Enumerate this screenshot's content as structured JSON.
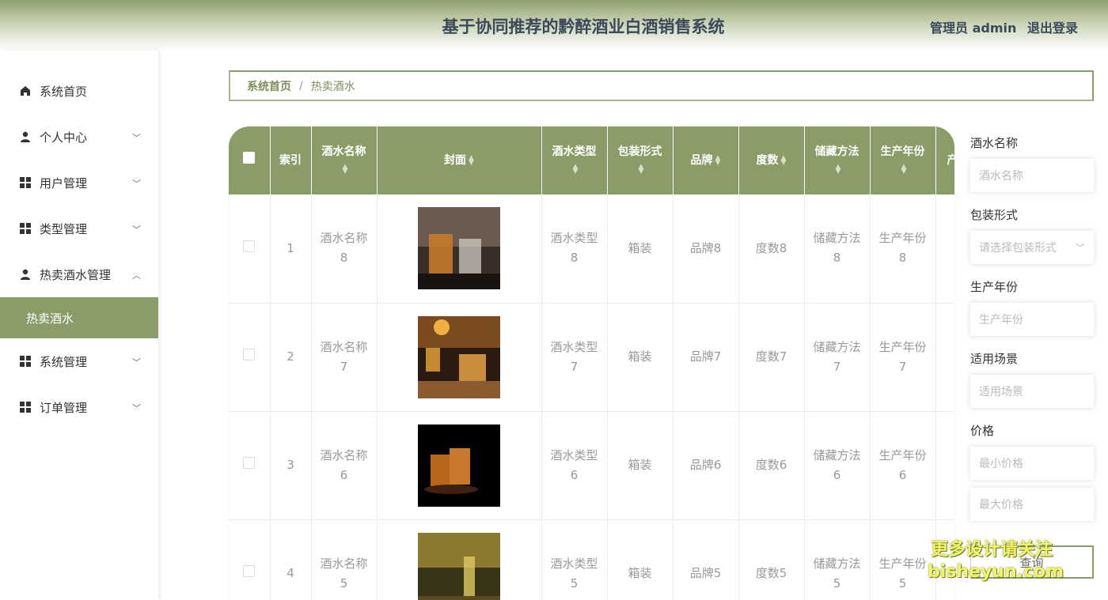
{
  "header": {
    "title": "基于协同推荐的黔醉酒业白酒销售系统",
    "user_label": "管理员 admin",
    "logout_label": "退出登录"
  },
  "sidebar": {
    "items": [
      {
        "label": "系统首页",
        "icon": "home-icon"
      },
      {
        "label": "个人中心",
        "icon": "user-icon"
      },
      {
        "label": "用户管理",
        "icon": "grid-icon"
      },
      {
        "label": "类型管理",
        "icon": "grid-icon"
      },
      {
        "label": "热卖酒水管理",
        "icon": "user-icon"
      },
      {
        "label": "系统管理",
        "icon": "grid-icon"
      },
      {
        "label": "订单管理",
        "icon": "grid-icon"
      }
    ],
    "sub_active": "热卖酒水"
  },
  "breadcrumb": {
    "home": "系统首页",
    "separator": "/",
    "current": "热卖酒水"
  },
  "table": {
    "headers": [
      "索引",
      "酒水名称",
      "封面",
      "酒水类型",
      "包装形式",
      "品牌",
      "度数",
      "储藏方法",
      "生产年份",
      "产"
    ],
    "rows": [
      {
        "index": "1",
        "name": "酒水名称8",
        "type": "酒水类型8",
        "pack": "箱装",
        "brand": "品牌8",
        "degree": "度数8",
        "storage": "储藏方法8",
        "year": "生产年份8"
      },
      {
        "index": "2",
        "name": "酒水名称7",
        "type": "酒水类型7",
        "pack": "箱装",
        "brand": "品牌7",
        "degree": "度数7",
        "storage": "储藏方法7",
        "year": "生产年份7"
      },
      {
        "index": "3",
        "name": "酒水名称6",
        "type": "酒水类型6",
        "pack": "箱装",
        "brand": "品牌6",
        "degree": "度数6",
        "storage": "储藏方法6",
        "year": "生产年份6"
      },
      {
        "index": "4",
        "name": "酒水名称5",
        "type": "酒水类型5",
        "pack": "箱装",
        "brand": "品牌5",
        "degree": "度数5",
        "storage": "储藏方法5",
        "year": "生产年份5"
      }
    ]
  },
  "filter": {
    "name_label": "酒水名称",
    "name_placeholder": "酒水名称",
    "pack_label": "包装形式",
    "pack_placeholder": "请选择包装形式",
    "year_label": "生产年份",
    "year_placeholder": "生产年份",
    "scene_label": "适用场景",
    "scene_placeholder": "适用场景",
    "price_label": "价格",
    "min_price_placeholder": "最小价格",
    "max_price_placeholder": "最大价格",
    "search_label": "查询"
  },
  "watermark": {
    "line1": "更多设计请关注",
    "line2": "bisheyun.com"
  },
  "colors": {
    "accent": "#8a9c68",
    "accent_dark": "#7d8f5c"
  }
}
